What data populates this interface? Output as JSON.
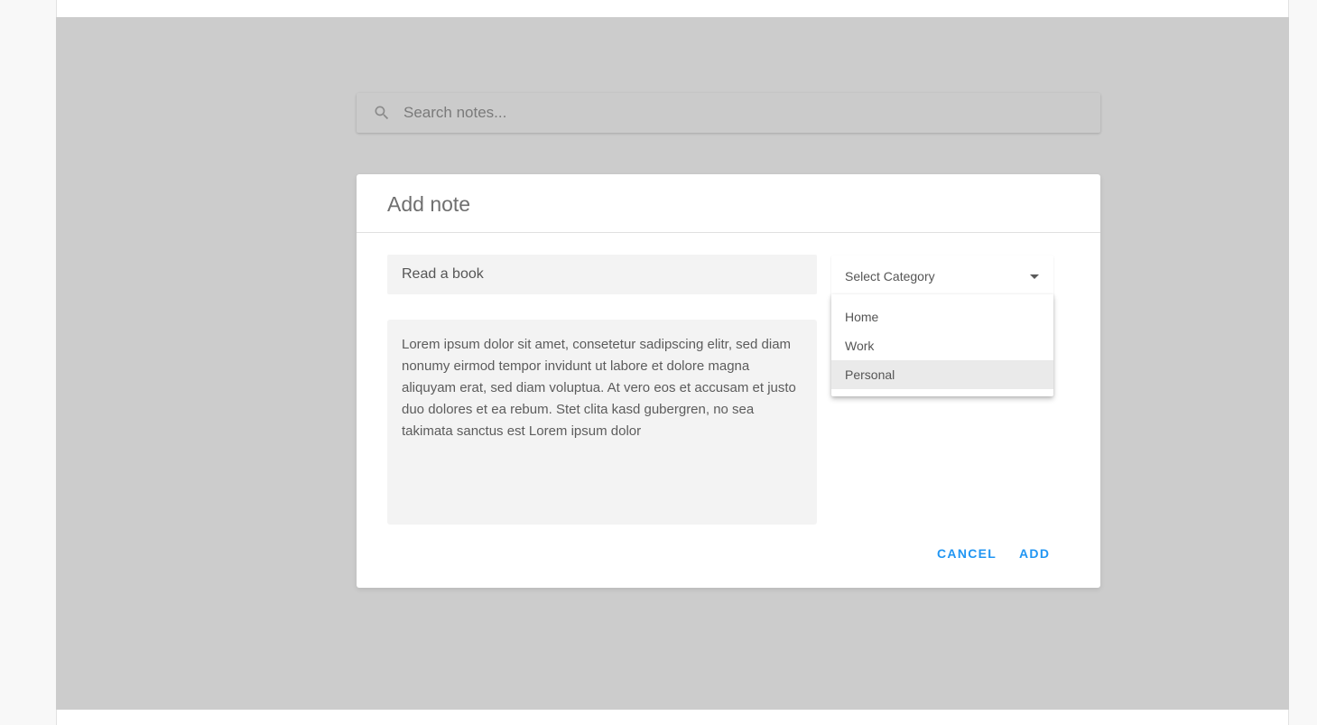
{
  "search": {
    "placeholder": "Search notes..."
  },
  "dialog": {
    "title": "Add note",
    "title_field_value": "Read a book",
    "body_text": "Lorem ipsum dolor sit amet, consetetur sadipscing elitr, sed diam nonumy eirmod tempor invidunt ut labore et dolore magna aliquyam erat, sed diam voluptua. At vero eos et accusam et justo duo dolores et ea rebum. Stet clita kasd gubergren, no sea takimata sanctus est Lorem ipsum dolor",
    "category": {
      "label": "Select Category",
      "options": [
        "Home",
        "Work",
        "Personal"
      ],
      "highlighted": "Personal"
    },
    "actions": {
      "cancel": "CANCEL",
      "add": "ADD"
    }
  },
  "colors": {
    "overlay": "#cccccc",
    "accent": "#2196f3",
    "field_background": "#f3f3f3"
  },
  "icons": {
    "search": "search-icon",
    "dropdown": "chevron-down-icon"
  }
}
